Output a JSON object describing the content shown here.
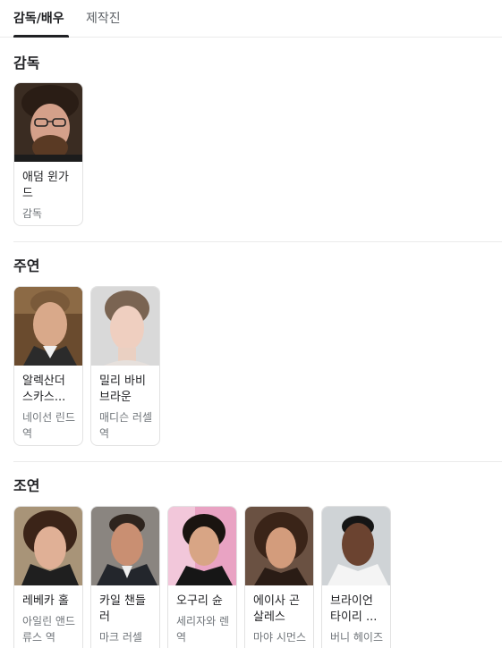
{
  "tabs": [
    {
      "label": "감독/배우",
      "active": true
    },
    {
      "label": "제작진",
      "active": false
    }
  ],
  "sections": {
    "director": {
      "title": "감독",
      "people": [
        {
          "name": "애덤 윈가드",
          "role": "감독"
        }
      ]
    },
    "lead": {
      "title": "주연",
      "people": [
        {
          "name": "알렉산더 스카스...",
          "role": "네이선 린드 역"
        },
        {
          "name": "밀리 바비 브라운",
          "role": "매디슨 러셀 역"
        }
      ]
    },
    "supporting": {
      "title": "조연",
      "people": [
        {
          "name": "레베카 홀",
          "role": "아일린 앤드류스 역"
        },
        {
          "name": "카일 챈들러",
          "role": "마크 러셀 역"
        },
        {
          "name": "오구리 슌",
          "role": "세리자와 렌 역"
        },
        {
          "name": "에이사 곤살레스",
          "role": "마야 시먼스 역"
        },
        {
          "name": "브라이언 타이리 ...",
          "role": "버니 헤이즈 역"
        }
      ]
    }
  },
  "colors": {
    "text": "#202124",
    "muted": "#70757a",
    "border": "#e2e2e2",
    "divider": "#ebebeb"
  }
}
